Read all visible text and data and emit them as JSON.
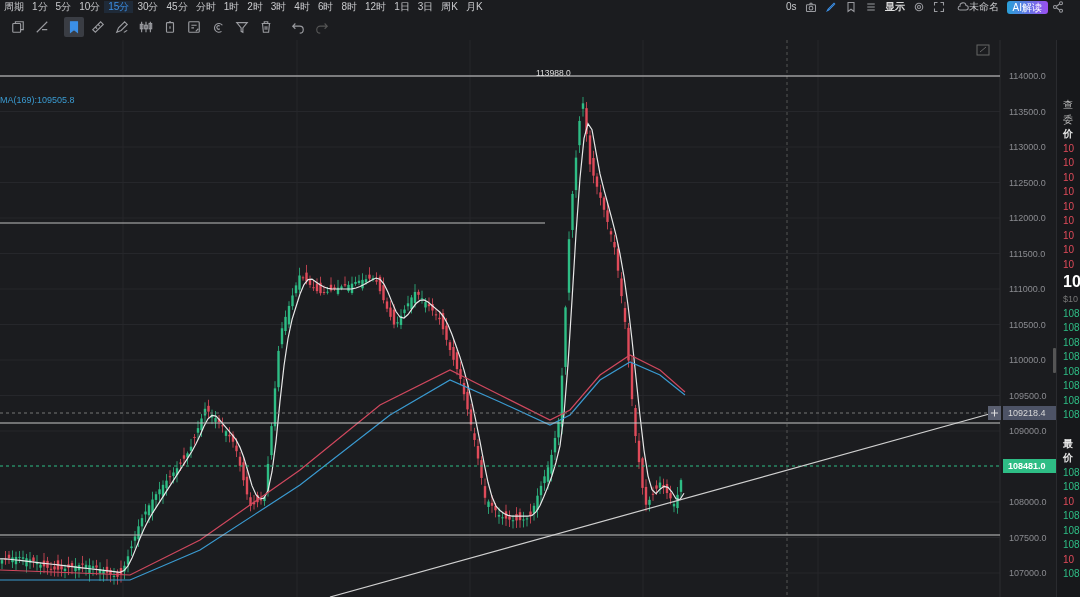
{
  "top_bar": {
    "period_label": "周期",
    "intervals": [
      {
        "label": "1分",
        "selected": false
      },
      {
        "label": "5分",
        "selected": false
      },
      {
        "label": "10分",
        "selected": false
      },
      {
        "label": "15分",
        "selected": true
      },
      {
        "label": "30分",
        "selected": false
      },
      {
        "label": "45分",
        "selected": false
      },
      {
        "label": "分时",
        "selected": false
      },
      {
        "label": "1时",
        "selected": false
      },
      {
        "label": "2时",
        "selected": false
      },
      {
        "label": "3时",
        "selected": false
      },
      {
        "label": "4时",
        "selected": false
      },
      {
        "label": "6时",
        "selected": false
      },
      {
        "label": "8时",
        "selected": false
      },
      {
        "label": "12时",
        "selected": false
      },
      {
        "label": "1日",
        "selected": false
      },
      {
        "label": "3日",
        "selected": false
      },
      {
        "label": "周K",
        "selected": false
      },
      {
        "label": "月K",
        "selected": false
      }
    ],
    "timer": "0s",
    "display_label": "显示",
    "layout_name": "未命名",
    "ai_button": "AI解读"
  },
  "toolbar": {
    "tools": [
      {
        "kind": "copy",
        "selected": false
      },
      {
        "kind": "line",
        "selected": false
      },
      {
        "kind": "bookmark",
        "selected": true
      },
      {
        "kind": "ruler",
        "selected": false
      },
      {
        "kind": "pen",
        "selected": false
      },
      {
        "kind": "candles",
        "selected": false
      },
      {
        "kind": "clipboard",
        "selected": false
      },
      {
        "kind": "note",
        "selected": false
      },
      {
        "kind": "magnet",
        "selected": false
      },
      {
        "kind": "filter",
        "selected": false
      },
      {
        "kind": "trash",
        "selected": false
      },
      {
        "kind": "undo",
        "selected": false
      },
      {
        "kind": "redo",
        "selected": false
      }
    ]
  },
  "chart": {
    "indicator_label": "MA(169):109505.8",
    "high_label": "113988.0",
    "price_ticks": [
      "114000.0",
      "113500.0",
      "113000.0",
      "112500.0",
      "112000.0",
      "111500.0",
      "111000.0",
      "110500.0",
      "110000.0",
      "109500.0",
      "109000.0",
      "108000.0",
      "107500.0",
      "107000.0"
    ],
    "crosshair_price": "109218.4",
    "last_price": "108481.0"
  },
  "side_panel": {
    "rows": [
      {
        "kind": "label",
        "text": "查"
      },
      {
        "kind": "label",
        "text": "委"
      },
      {
        "kind": "header",
        "text": "价"
      },
      {
        "kind": "ask",
        "text": "10"
      },
      {
        "kind": "ask",
        "text": "10"
      },
      {
        "kind": "ask",
        "text": "10"
      },
      {
        "kind": "ask",
        "text": "10"
      },
      {
        "kind": "ask",
        "text": "10"
      },
      {
        "kind": "ask",
        "text": "10"
      },
      {
        "kind": "ask",
        "text": "10"
      },
      {
        "kind": "ask",
        "text": "10"
      },
      {
        "kind": "ask",
        "text": "10"
      },
      {
        "kind": "big",
        "text": "10"
      },
      {
        "kind": "sub",
        "text": "$10"
      },
      {
        "kind": "bid",
        "text": "108"
      },
      {
        "kind": "bid",
        "text": "108"
      },
      {
        "kind": "bid",
        "text": "108"
      },
      {
        "kind": "bid",
        "text": "108"
      },
      {
        "kind": "bid",
        "text": "108"
      },
      {
        "kind": "bid",
        "text": "108"
      },
      {
        "kind": "bid",
        "text": "108"
      },
      {
        "kind": "bid",
        "text": "108"
      },
      {
        "kind": "gap",
        "text": "最"
      },
      {
        "kind": "header",
        "text": "价"
      },
      {
        "kind": "bid",
        "text": "108"
      },
      {
        "kind": "bid",
        "text": "108"
      },
      {
        "kind": "ask",
        "text": "10"
      },
      {
        "kind": "bid",
        "text": "108"
      },
      {
        "kind": "bid",
        "text": "108"
      },
      {
        "kind": "bid",
        "text": "108"
      },
      {
        "kind": "ask",
        "text": "10"
      },
      {
        "kind": "bid",
        "text": "108"
      }
    ]
  }
}
